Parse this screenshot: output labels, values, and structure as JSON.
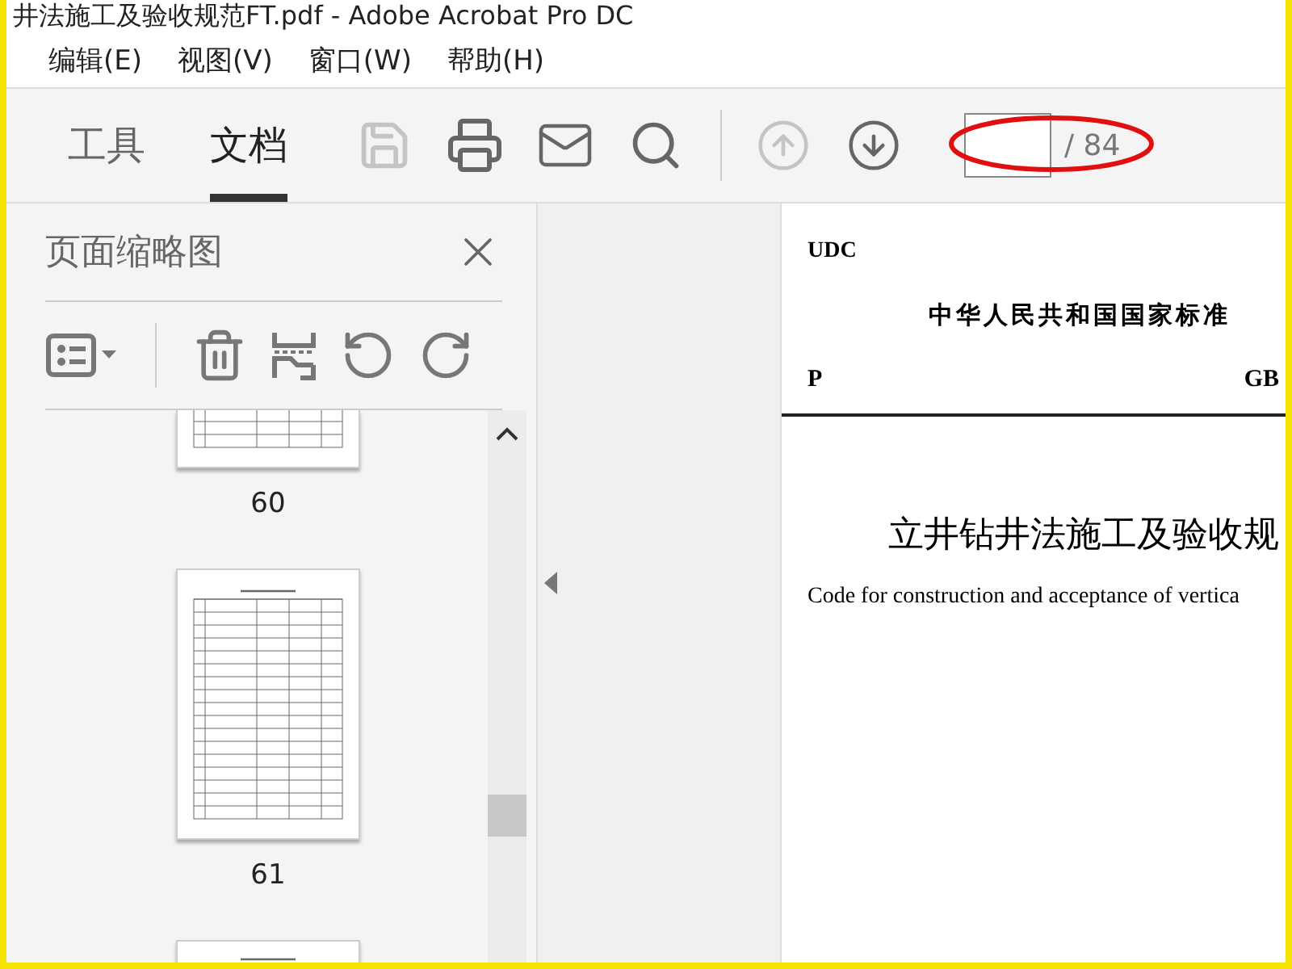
{
  "window": {
    "title": "井法施工及验收规范FT.pdf - Adobe Acrobat Pro DC"
  },
  "menu": [
    "编辑(E)",
    "视图(V)",
    "窗口(W)",
    "帮助(H)"
  ],
  "tabs": [
    {
      "label": "工具",
      "selected": false
    },
    {
      "label": "文档",
      "selected": true
    }
  ],
  "toolbar": {
    "save_disabled": true,
    "previous_disabled": true,
    "page_total": "/ 84"
  },
  "thumbnails_panel": {
    "title": "页面缩略图",
    "pages": [
      {
        "label": "60"
      },
      {
        "label": "61"
      }
    ]
  },
  "document": {
    "udc": "UDC",
    "heading": "中华人民共和国国家标准",
    "left_code": "P",
    "right_code": "GB",
    "title": "立井钻井法施工及验收规",
    "subtitle": "Code for construction and acceptance of vertica"
  }
}
